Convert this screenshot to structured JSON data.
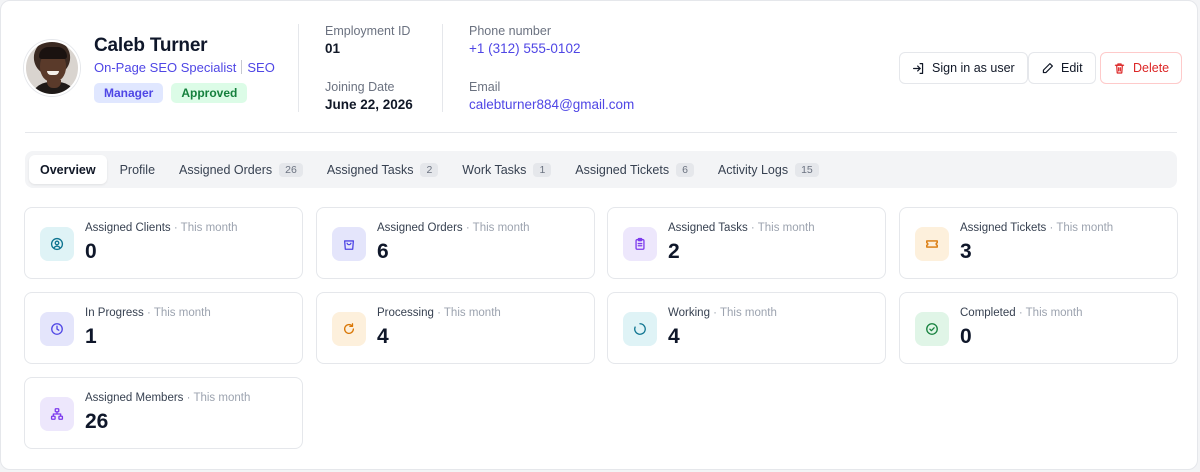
{
  "profile": {
    "name": "Caleb Turner",
    "role": "On-Page SEO Specialist",
    "department": "SEO",
    "badges": {
      "manager": "Manager",
      "approved": "Approved"
    }
  },
  "meta": {
    "employment_id_label": "Employment ID",
    "employment_id": "01",
    "joining_date_label": "Joining Date",
    "joining_date": "June 22, 2026",
    "phone_label": "Phone number",
    "phone": "+1 (312) 555-0102",
    "email_label": "Email",
    "email": "calebturner884@gmail.com"
  },
  "actions": {
    "sign_in": "Sign in as user",
    "edit": "Edit",
    "delete": "Delete"
  },
  "tabs": [
    {
      "label": "Overview"
    },
    {
      "label": "Profile"
    },
    {
      "label": "Assigned Orders",
      "count": "26"
    },
    {
      "label": "Assigned Tasks",
      "count": "2"
    },
    {
      "label": "Work Tasks",
      "count": "1"
    },
    {
      "label": "Assigned Tickets",
      "count": "6"
    },
    {
      "label": "Activity Logs",
      "count": "15"
    }
  ],
  "period_text": "· This month",
  "stats": [
    {
      "label": "Assigned Clients",
      "value": "0",
      "icon": "user-circle-icon",
      "color": "#0e7490",
      "bg": "#dff3f6"
    },
    {
      "label": "Assigned Orders",
      "value": "6",
      "icon": "shopping-bag-icon",
      "color": "#4f46e5",
      "bg": "#e4e5fb"
    },
    {
      "label": "Assigned Tasks",
      "value": "2",
      "icon": "clipboard-icon",
      "color": "#7c3aed",
      "bg": "#ede7fc"
    },
    {
      "label": "Assigned Tickets",
      "value": "3",
      "icon": "ticket-icon",
      "color": "#d97706",
      "bg": "#fdf0dc"
    },
    {
      "label": "In Progress",
      "value": "1",
      "icon": "clock-icon",
      "color": "#4f46e5",
      "bg": "#e4e5fb"
    },
    {
      "label": "Processing",
      "value": "4",
      "icon": "refresh-icon",
      "color": "#d97706",
      "bg": "#fdf0dc"
    },
    {
      "label": "Working",
      "value": "4",
      "icon": "loader-icon",
      "color": "#0e7490",
      "bg": "#dff3f6"
    },
    {
      "label": "Completed",
      "value": "0",
      "icon": "check-circle-icon",
      "color": "#15803d",
      "bg": "#e0f5e7"
    },
    {
      "label": "Assigned Members",
      "value": "26",
      "icon": "network-icon",
      "color": "#7c3aed",
      "bg": "#ede7fc"
    }
  ]
}
